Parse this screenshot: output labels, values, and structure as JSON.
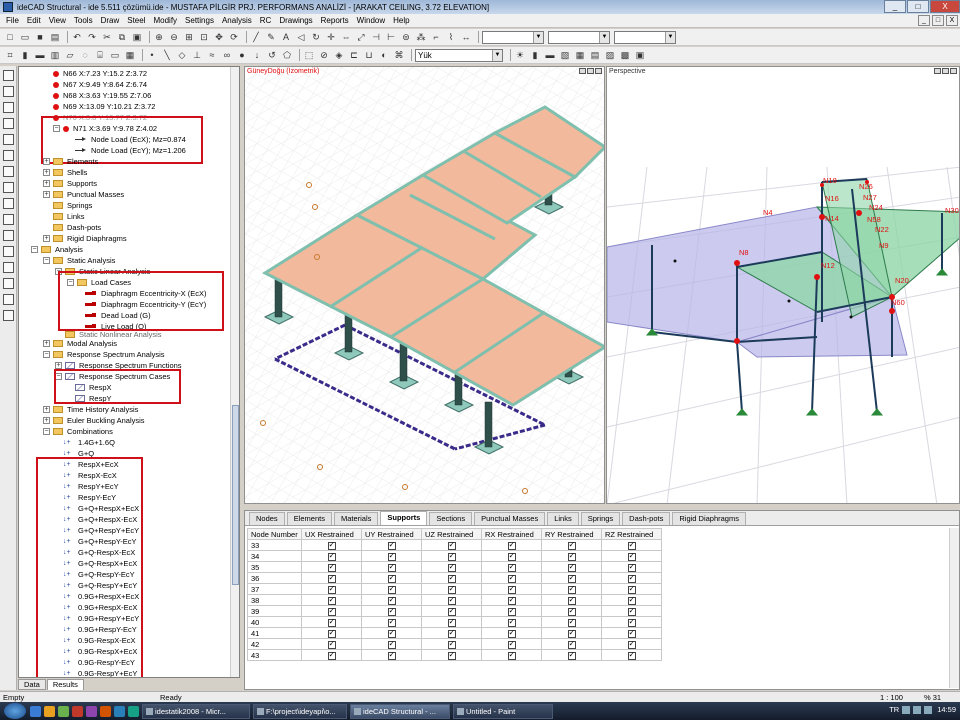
{
  "window": {
    "title": "ideCAD Structural - ide 5.511 çözümü.ide - MUSTAFA PİLGİR PRJ. PERFORMANS ANALİZİ - [ARAKAT CEILING,  3.72 ELEVATION]",
    "minimize": "_",
    "maximize": "□",
    "close": "X"
  },
  "menu": [
    "File",
    "Edit",
    "View",
    "Tools",
    "Draw",
    "Steel",
    "Modify",
    "Settings",
    "Analysis",
    "RC",
    "Drawings",
    "Reports",
    "Window",
    "Help"
  ],
  "mdi_controls": [
    "_",
    "□",
    "X"
  ],
  "toolbar": {
    "combo1": "",
    "combo2": "",
    "combo3": "",
    "load_combo": "Yük"
  },
  "tree": {
    "nodes": [
      {
        "label": "N66 X:7.23 Y:15.2 Z:3.72"
      },
      {
        "label": "N67 X:9.49 Y:8.64 Z:6.74"
      },
      {
        "label": "N68 X:3.63 Y:19.55 Z:7.06"
      },
      {
        "label": "N69 X:13.09 Y:10.21 Z:3.72"
      },
      {
        "label": "N70 X:3.8 Y:13.77 Z:3.72"
      },
      {
        "label": "N71 X:3.69 Y:9.78 Z:4.02"
      }
    ],
    "node_loads": [
      "Node Load (EcX); Mz=0.874",
      "Node Load (EcY); Mz=1.206"
    ],
    "model_items": [
      "Elements",
      "Shells",
      "Supports",
      "Punctual Masses",
      "Springs",
      "Links",
      "Dash-pots",
      "Rigid Diaphragms"
    ],
    "analysis": "Analysis",
    "static_analysis": "Static Analysis",
    "static_linear": "Static Linear Analysis",
    "load_cases": "Load Cases",
    "load_case_items": [
      "Diaphragm Eccentricity-X (EcX)",
      "Diaphragm Eccentricity-Y (EcY)",
      "Dead Load (G)",
      "Live Load (Q)"
    ],
    "static_nonlinear": "Static Nonlinear Analysis",
    "modal": "Modal Analysis",
    "response_spectrum": "Response Spectrum Analysis",
    "rs_functions": "Response Spectrum Functions",
    "rs_cases": "Response Spectrum Cases",
    "rs_case_items": [
      "RespX",
      "RespY"
    ],
    "time_history": "Time History Analysis",
    "euler": "Euler Buckling Analysis",
    "combinations": "Combinations",
    "combination_items": [
      "1.4G+1.6Q",
      "G+Q",
      "RespX+EcX",
      "RespX-EcX",
      "RespY+EcY",
      "RespY-EcY",
      "G+Q+RespX+EcX",
      "G+Q+RespX-EcX",
      "G+Q+RespY+EcY",
      "G+Q+RespY-EcY",
      "G+Q-RespX-EcX",
      "G+Q-RespX+EcX",
      "G+Q-RespY-EcY",
      "G+Q-RespY+EcY",
      "0.9G+RespX+EcX",
      "0.9G+RespX-EcX",
      "0.9G+RespY+EcY",
      "0.9G+RespY-EcY",
      "0.9G-RespX-EcX",
      "0.9G-RespX+EcX",
      "0.9G-RespY-EcY",
      "0.9G-RespY+EcY"
    ],
    "tabs": [
      "Data",
      "Results"
    ]
  },
  "viewports": {
    "left_label": "GüneyDoğu (İzometrik)",
    "right_label": "Perspective",
    "node_labels": [
      "N18",
      "N26",
      "N16",
      "N27",
      "N4",
      "N14",
      "N24",
      "N58",
      "N30",
      "N22",
      "N9",
      "N8",
      "N12",
      "N20",
      "N60"
    ]
  },
  "table": {
    "tabs": [
      "Nodes",
      "Elements",
      "Materials",
      "Supports",
      "Sections",
      "Punctual Masses",
      "Links",
      "Springs",
      "Dash-pots",
      "Rigid Diaphragms"
    ],
    "active_tab": "Supports",
    "columns": [
      "Node Number",
      "UX Restrained",
      "UY Restrained",
      "UZ Restrained",
      "RX Restrained",
      "RY Restrained",
      "RZ Restrained"
    ],
    "rows": [
      {
        "node": "33",
        "ux": true,
        "uy": true,
        "uz": true,
        "rx": true,
        "ry": true,
        "rz": true
      },
      {
        "node": "34",
        "ux": true,
        "uy": true,
        "uz": true,
        "rx": true,
        "ry": true,
        "rz": true
      },
      {
        "node": "35",
        "ux": true,
        "uy": true,
        "uz": true,
        "rx": true,
        "ry": true,
        "rz": true
      },
      {
        "node": "36",
        "ux": true,
        "uy": true,
        "uz": true,
        "rx": true,
        "ry": true,
        "rz": true
      },
      {
        "node": "37",
        "ux": true,
        "uy": true,
        "uz": true,
        "rx": true,
        "ry": true,
        "rz": true
      },
      {
        "node": "38",
        "ux": true,
        "uy": true,
        "uz": true,
        "rx": true,
        "ry": true,
        "rz": true
      },
      {
        "node": "39",
        "ux": true,
        "uy": true,
        "uz": true,
        "rx": true,
        "ry": true,
        "rz": true
      },
      {
        "node": "40",
        "ux": true,
        "uy": true,
        "uz": true,
        "rx": true,
        "ry": true,
        "rz": true
      },
      {
        "node": "41",
        "ux": true,
        "uy": true,
        "uz": true,
        "rx": true,
        "ry": true,
        "rz": true
      },
      {
        "node": "42",
        "ux": true,
        "uy": true,
        "uz": true,
        "rx": true,
        "ry": true,
        "rz": true
      },
      {
        "node": "43",
        "ux": true,
        "uy": true,
        "uz": true,
        "rx": true,
        "ry": true,
        "rz": true
      }
    ]
  },
  "status": {
    "left": "Empty",
    "middle": "Ready",
    "scale": "1 : 100",
    "zoom": "% 31"
  },
  "taskbar": {
    "items": [
      "idestatik2008 - Micr...",
      "F:\\project\\ideyapi\\o...",
      "ideCAD Structural - ...",
      "Untitled - Paint"
    ],
    "active_index": 2,
    "language": "TR",
    "clock": "14:59"
  },
  "colors": {
    "slab": "#f2b99c",
    "beam": "#7fbfae",
    "column_dark": "#2e4f4a",
    "highlight_red": "#d01018",
    "shell_green": "#8fd6a8",
    "shell_purple": "#b7b5e8"
  }
}
